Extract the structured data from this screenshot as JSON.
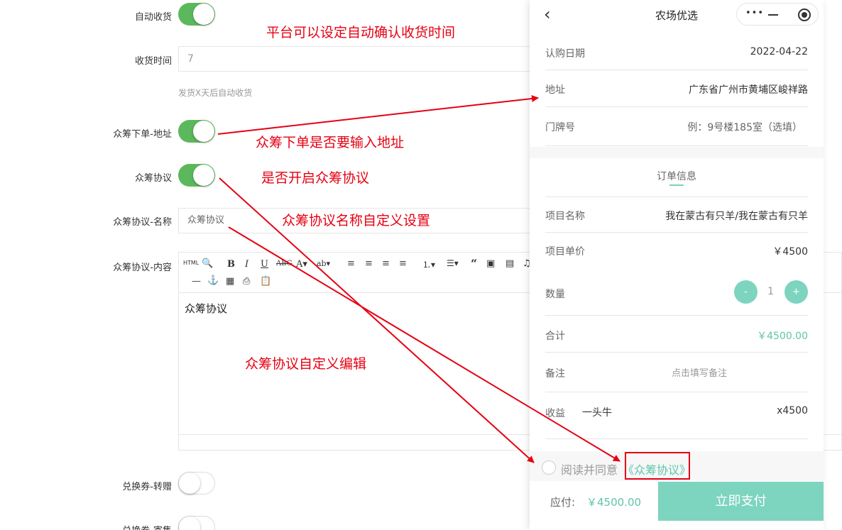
{
  "form": {
    "auto_receive_label": "自动收货",
    "auto_receive_on": true,
    "receive_time_label": "收货时间",
    "receive_time_value": "7",
    "receive_time_hint": "发货X天后自动收货",
    "crowdfund_address_label": "众筹下单-地址",
    "crowdfund_address_on": true,
    "crowdfund_agreement_label": "众筹协议",
    "crowdfund_agreement_on": true,
    "agreement_name_label": "众筹协议-名称",
    "agreement_name_value": "众筹协议",
    "agreement_content_label": "众筹协议-内容",
    "agreement_content_text": "众筹协议",
    "voucher_transfer_label": "兑换券-转赠",
    "voucher_transfer_on": false,
    "voucher_sell_label": "兑换券-寄售",
    "voucher_sell_on": false
  },
  "editor_toolbar": {
    "html_label": "HTML",
    "icons": [
      "html-icon",
      "preview-icon",
      "bold-icon",
      "italic-icon",
      "underline-icon",
      "strikethrough-icon",
      "font-color-icon",
      "highlight-icon",
      "align-left-icon",
      "align-center-icon",
      "align-right-icon",
      "align-justify-icon",
      "ordered-list-icon",
      "unordered-list-icon",
      "quote-icon",
      "image-icon",
      "video-icon",
      "music-icon",
      "horizontal-rule-icon",
      "anchor-icon",
      "table-icon",
      "print-icon",
      "paste-icon"
    ]
  },
  "annotations": {
    "a1": "平台可以设定自动确认收货时间",
    "a2": "众筹下单是否要输入地址",
    "a3": "是否开启众筹协议",
    "a4": "众筹协议名称自定义设置",
    "a5": "众筹协议自定义编辑"
  },
  "phone": {
    "nav_title": "农场优选",
    "subscribe_date_label": "认购日期",
    "subscribe_date_value": "2022-04-22",
    "address_label": "地址",
    "address_value": "广东省广州市黄埔区峻祥路",
    "door_label": "门牌号",
    "door_placeholder": "例：9号楼185室（选填）",
    "order_info_title": "订单信息",
    "project_name_label": "项目名称",
    "project_name_value": "我在蒙古有只羊/我在蒙古有只羊",
    "unit_price_label": "项目单价",
    "unit_price_value": "￥4500",
    "quantity_label": "数量",
    "quantity_minus": "-",
    "quantity_value": "1",
    "quantity_plus": "+",
    "total_label": "合计",
    "total_value": "￥4500.00",
    "remark_label": "备注",
    "remark_placeholder": "点击填写备注",
    "income_label": "收益",
    "income_item": "一头牛",
    "income_value": "x4500",
    "agree_text": "阅读并同意",
    "agree_link": "《众筹协议》",
    "pay_label": "应付:",
    "pay_amount": "￥4500.00",
    "pay_button": "立即支付"
  },
  "colors": {
    "toggle_on": "#5cb85c",
    "accent": "#7dd4bf",
    "annotation": "#e60012"
  }
}
